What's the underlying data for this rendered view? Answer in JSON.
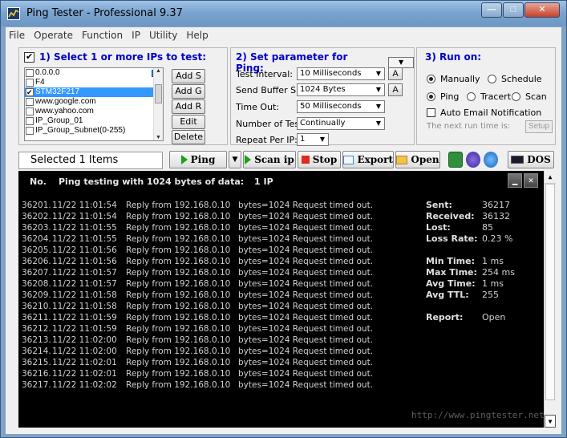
{
  "window": {
    "title": "Ping Tester - Professional  9.37",
    "min_glyph": "—",
    "max_glyph": "□",
    "close_glyph": "✕"
  },
  "menu": [
    "File",
    "Operate",
    "Function",
    "IP",
    "Utility",
    "Help"
  ],
  "select_ips": {
    "title": "1) Select 1 or more IPs to test:",
    "checked": true,
    "items": [
      {
        "label": "0.0.0.0",
        "checked": false,
        "selected": false
      },
      {
        "label": "F4",
        "checked": false,
        "selected": false
      },
      {
        "label": "STM32F217",
        "checked": true,
        "selected": true
      },
      {
        "label": "www.google.com",
        "checked": false,
        "selected": false
      },
      {
        "label": "www.yahoo.com",
        "checked": false,
        "selected": false
      },
      {
        "label": "IP_Group_01",
        "checked": false,
        "selected": false
      },
      {
        "label": "IP_Group_Subnet(0-255)",
        "checked": false,
        "selected": false
      }
    ],
    "buttons": {
      "add_s": "Add S",
      "add_g": "Add G",
      "add_r": "Add R",
      "edit": "Edit",
      "delete": "Delete"
    }
  },
  "params": {
    "title": "2) Set parameter for Ping:",
    "test_interval": {
      "label": "Test Interval:",
      "value": "10 Milliseconds"
    },
    "buffer_size": {
      "label": "Send Buffer Size:",
      "value": "1024 Bytes"
    },
    "time_out": {
      "label": "Time Out:",
      "value": "50 Milliseconds"
    },
    "num_tests": {
      "label": "Number of Test:",
      "value": "Continually"
    },
    "repeat": {
      "label": "Repeat Per IP:",
      "value": "1"
    },
    "a_label": "A"
  },
  "run_on": {
    "title": "3) Run on:",
    "manually": "Manually",
    "schedule": "Schedule",
    "ping": "Ping",
    "tracert": "Tracert",
    "scan": "Scan",
    "auto_email": "Auto Email Notification",
    "next_run": "The next run time is:",
    "setup": "Setup"
  },
  "toolbar": {
    "selected": "Selected 1 Items",
    "ping": "Ping",
    "scan_ip": "Scan ip",
    "stop": "Stop",
    "export": "Export",
    "open": "Open",
    "dos": "DOS"
  },
  "console": {
    "col_no": "No.",
    "header": "Ping testing with 1024 bytes of data:",
    "ip_count": "1  IP",
    "rows": [
      {
        "no": "36201.",
        "time": "11/22 11:01:54",
        "reply": "Reply from 192.168.0.10",
        "result": "bytes=1024  Request  timed  out."
      },
      {
        "no": "36202.",
        "time": "11/22 11:01:54",
        "reply": "Reply from 192.168.0.10",
        "result": "bytes=1024  Request  timed  out."
      },
      {
        "no": "36203.",
        "time": "11/22 11:01:55",
        "reply": "Reply from 192.168.0.10",
        "result": "bytes=1024  Request  timed  out."
      },
      {
        "no": "36204.",
        "time": "11/22 11:01:55",
        "reply": "Reply from 192.168.0.10",
        "result": "bytes=1024  Request  timed  out."
      },
      {
        "no": "36205.",
        "time": "11/22 11:01:56",
        "reply": "Reply from 192.168.0.10",
        "result": "bytes=1024  Request  timed  out."
      },
      {
        "no": "36206.",
        "time": "11/22 11:01:56",
        "reply": "Reply from 192.168.0.10",
        "result": "bytes=1024  Request  timed  out."
      },
      {
        "no": "36207.",
        "time": "11/22 11:01:57",
        "reply": "Reply from 192.168.0.10",
        "result": "bytes=1024  Request  timed  out."
      },
      {
        "no": "36208.",
        "time": "11/22 11:01:57",
        "reply": "Reply from 192.168.0.10",
        "result": "bytes=1024  Request  timed  out."
      },
      {
        "no": "36209.",
        "time": "11/22 11:01:58",
        "reply": "Reply from 192.168.0.10",
        "result": "bytes=1024  Request  timed  out."
      },
      {
        "no": "36210.",
        "time": "11/22 11:01:58",
        "reply": "Reply from 192.168.0.10",
        "result": "bytes=1024  Request  timed  out."
      },
      {
        "no": "36211.",
        "time": "11/22 11:01:59",
        "reply": "Reply from 192.168.0.10",
        "result": "bytes=1024  Request  timed  out."
      },
      {
        "no": "36212.",
        "time": "11/22 11:01:59",
        "reply": "Reply from 192.168.0.10",
        "result": "bytes=1024  Request  timed  out."
      },
      {
        "no": "36213.",
        "time": "11/22 11:02:00",
        "reply": "Reply from 192.168.0.10",
        "result": "bytes=1024  Request  timed  out."
      },
      {
        "no": "36214.",
        "time": "11/22 11:02:00",
        "reply": "Reply from 192.168.0.10",
        "result": "bytes=1024  Request  timed  out."
      },
      {
        "no": "36215.",
        "time": "11/22 11:02:01",
        "reply": "Reply from 192.168.0.10",
        "result": "bytes=1024  Request  timed  out."
      },
      {
        "no": "36216.",
        "time": "11/22 11:02:01",
        "reply": "Reply from 192.168.0.10",
        "result": "bytes=1024  Request  timed  out."
      },
      {
        "no": "36217.",
        "time": "11/22 11:02:02",
        "reply": "Reply from 192.168.0.10",
        "result": "bytes=1024  Request  timed  out."
      }
    ],
    "stats": {
      "sent_label": "Sent:",
      "sent": "36217",
      "received_label": "Received:",
      "received": "36132",
      "lost_label": "Lost:",
      "lost": "85",
      "loss_rate_label": "Loss Rate:",
      "loss_rate": "0.23 %",
      "min_label": "Min Time:",
      "min": "1 ms",
      "max_label": "Max Time:",
      "max": "254 ms",
      "avg_label": "Avg Time:",
      "avg": "1 ms",
      "ttl_label": "Avg TTL:",
      "ttl": "255",
      "report_label": "Report:",
      "report": "Open"
    },
    "watermark": "http://www.pingtester.net"
  },
  "colors": {
    "group_title": "#0000c8",
    "console_bg": "#000000",
    "selection": "#3399ff"
  }
}
